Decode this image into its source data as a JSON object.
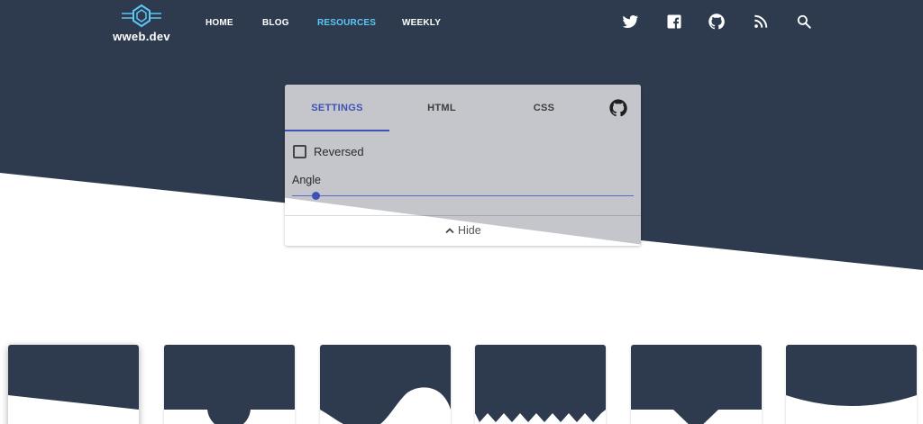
{
  "colors": {
    "navy": "#2e3b4e",
    "accent_link": "#5bc8f5",
    "tab_active": "#3f51b5",
    "panel_bg": "#ffffff"
  },
  "site": {
    "logo_text": "wweb.dev"
  },
  "nav": {
    "links": [
      {
        "label": "HOME",
        "active": false
      },
      {
        "label": "BLOG",
        "active": false
      },
      {
        "label": "RESOURCES",
        "active": true
      },
      {
        "label": "WEEKLY",
        "active": false
      }
    ],
    "icons": [
      "twitter-icon",
      "facebook-icon",
      "github-icon",
      "rss-icon",
      "search-icon"
    ]
  },
  "panel": {
    "tabs": [
      {
        "label": "SETTINGS",
        "active": true
      },
      {
        "label": "HTML",
        "active": false
      },
      {
        "label": "CSS",
        "active": false
      }
    ],
    "github_icon": "github-icon",
    "reversed_label": "Reversed",
    "reversed_checked": false,
    "angle_label": "Angle",
    "angle_level": 0.07,
    "hide_label": "Hide",
    "hide_icon": "chevron-up-icon"
  },
  "shape_cards": [
    {
      "shape": "slant"
    },
    {
      "shape": "circle"
    },
    {
      "shape": "wave"
    },
    {
      "shape": "zigzag"
    },
    {
      "shape": "triangle"
    },
    {
      "shape": "curve"
    }
  ]
}
